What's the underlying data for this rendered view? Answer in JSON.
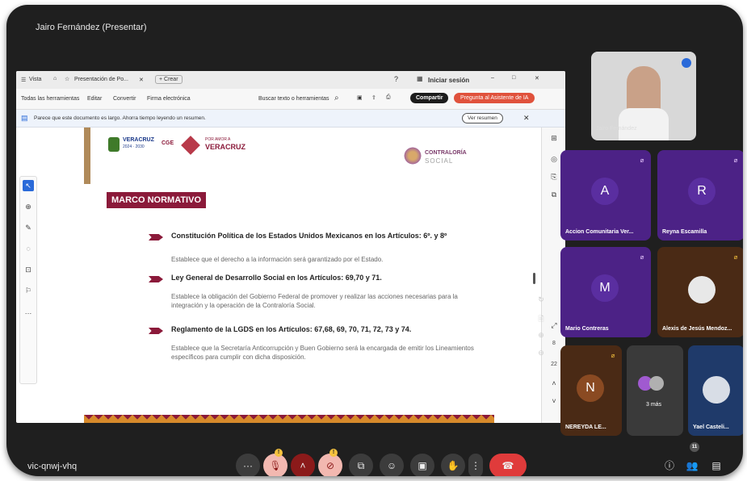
{
  "meet": {
    "presenter_title": "Jairo Fernández (Presentar)",
    "meeting_code": "vic-qnwj-vhq",
    "participants_badge": "11"
  },
  "browser": {
    "view_label": "Vista",
    "tab_label": "Presentación de Po...",
    "new_tab_label": "+ Crear",
    "signin_label": "Iniciar sesión",
    "min_icon": "–",
    "max_icon": "□",
    "close_icon": "✕",
    "toolbar": {
      "all_tools": "Todas las herramientas",
      "edit": "Editar",
      "convert": "Convertir",
      "esign": "Firma electrónica",
      "search": "Buscar texto o herramientas",
      "share": "Compartir",
      "ai_assistant": "Pregunta al Asistente de IA"
    },
    "notice": {
      "text": "Parece que este documento es largo. Ahorra tiempo leyendo un resumen.",
      "button": "Ver resumen"
    },
    "page_number": "8",
    "page_total": "22"
  },
  "document": {
    "logo_veracruz": "VERACRUZ",
    "logo_years": "2024 · 2030",
    "logo_cge": "CGE",
    "logo_por_amor": "POR AMOR A",
    "logo_veracruz_red": "VERACRUZ",
    "logo_contraloria": "CONTRALORÍA",
    "logo_social": "SOCIAL",
    "heading": "MARCO NORMATIVO",
    "items": [
      {
        "title": "Constitución Política de los Estados Unidos Mexicanos en los Artículos:  6º. y 8º",
        "desc": "Establece que el derecho a la información será garantizado por el Estado."
      },
      {
        "title": "Ley General de Desarrollo Social en los Artículos: 69,70 y 71.",
        "desc": "Establece la obligación del Gobierno Federal de promover y realizar las acciones necesarias para la integración y la operación de la Contraloría Social."
      },
      {
        "title": "Reglamento de la LGDS en los Artículos: 67,68, 69, 70, 71, 72, 73 y 74.",
        "desc": "Establece que la Secretaría Anticorrupción y Buen Gobierno será la encargada de emitir los Lineamientos específicos para cumplir con dicha disposición."
      }
    ]
  },
  "tiles": [
    {
      "name": "Jairo Fernández",
      "type": "video"
    },
    {
      "initial": "A",
      "name": "Accion Comunitaria Ver..."
    },
    {
      "initial": "R",
      "name": "Reyna Escamilla"
    },
    {
      "initial": "M",
      "name": "Mario Contreras"
    },
    {
      "name": "Alexis de Jesús Mendoz..."
    },
    {
      "initial": "N",
      "name": "NEREYDA LE..."
    },
    {
      "name": "3 más"
    },
    {
      "name": "Yael Casteli..."
    }
  ],
  "controls": {
    "more_label": "···",
    "mic_badge": "!",
    "cam_badge": "!",
    "more_options": "⋮"
  },
  "colors": {
    "accent_purple": "#4c2286",
    "end_call": "#e03b3b",
    "maroon": "#8b1a3a"
  }
}
